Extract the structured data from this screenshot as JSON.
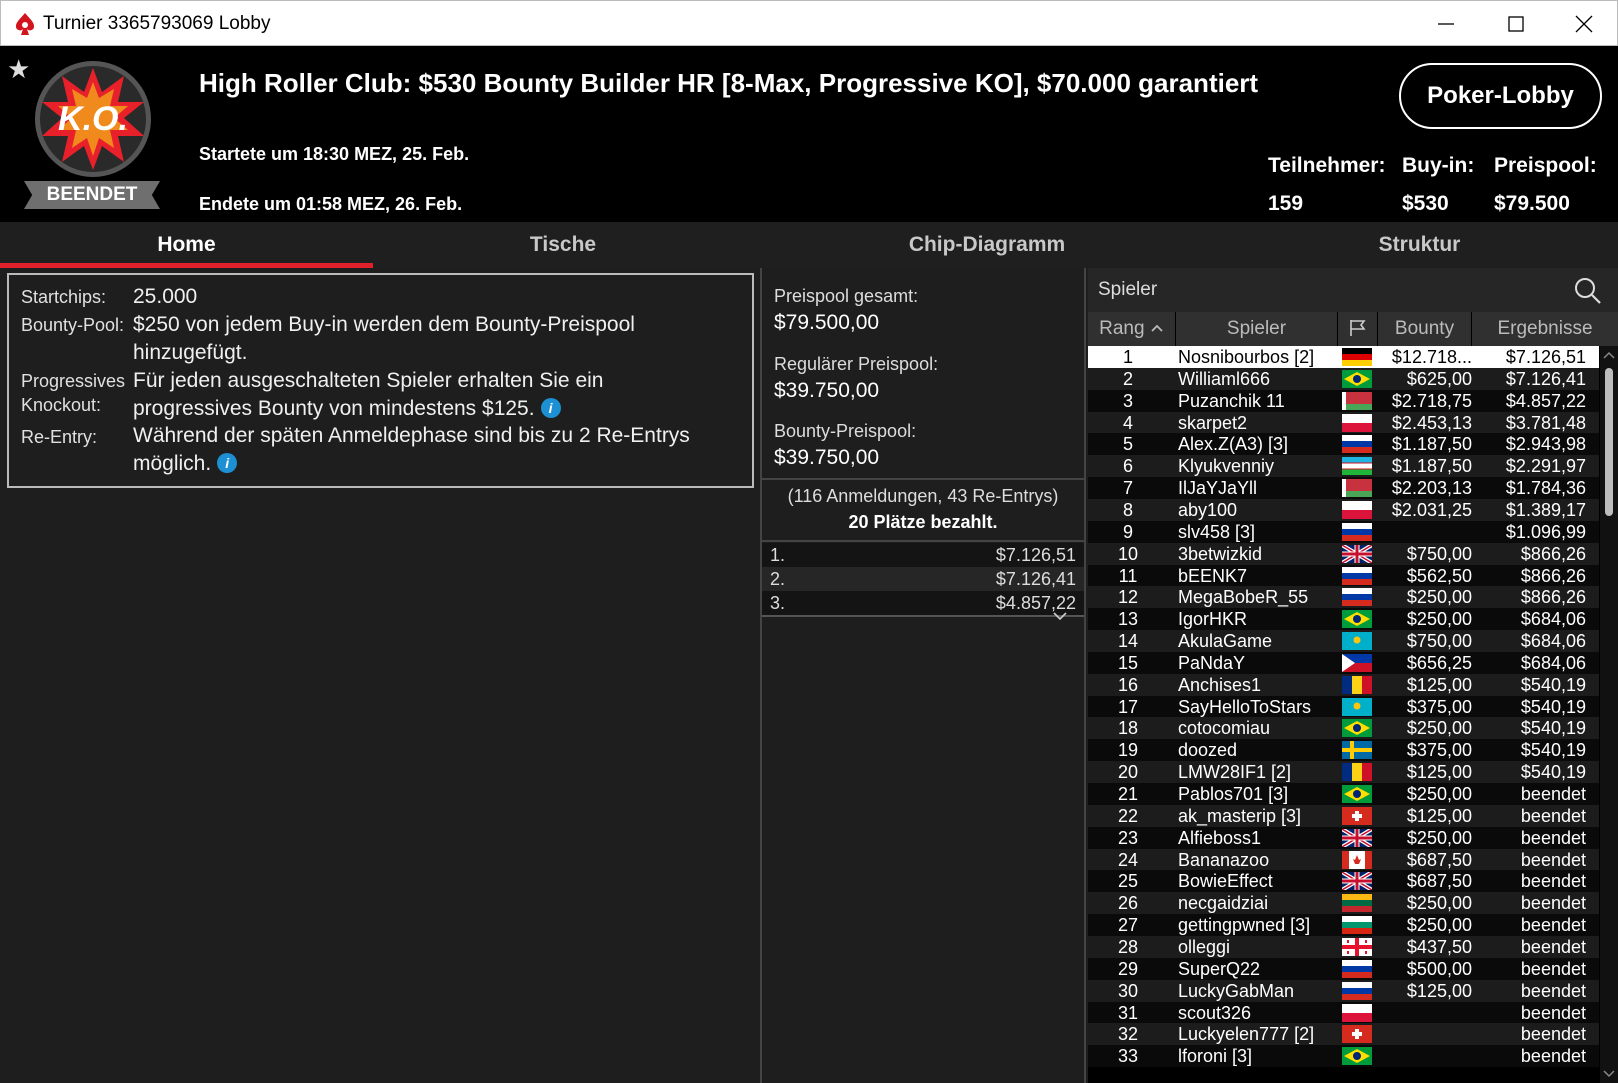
{
  "window": {
    "title": "Turnier 3365793069 Lobby"
  },
  "header": {
    "status_badge": "BEENDET",
    "logo_text": "K.O.",
    "tournament_title": "High Roller Club: $530 Bounty Builder HR [8-Max, Progressive KO], $70.000 garantiert",
    "started": "Startete um 18:30 MEZ, 25. Feb.",
    "ended": "Endete um 01:58 MEZ, 26. Feb.",
    "lobby_button": "Poker-Lobby",
    "stats": [
      {
        "label": "Teilnehmer:",
        "value": "159"
      },
      {
        "label": "Buy-in:",
        "value": "$530"
      },
      {
        "label": "Preispool:",
        "value": "$79.500"
      }
    ]
  },
  "tabs": [
    "Home",
    "Tische",
    "Chip-Diagramm",
    "Struktur"
  ],
  "info": {
    "startchips_label": "Startchips:",
    "startchips_value": "25.000",
    "bounty_pool_label": "Bounty-Pool:",
    "bounty_pool_value": "$250 von jedem Buy-in werden dem Bounty-Preispool hinzugefügt.",
    "progressive_label_1": "Progressives",
    "progressive_label_2": "Knockout:",
    "progressive_value": "Für jeden ausgeschalteten Spieler erhalten Sie ein progressives Bounty von mindestens $125.",
    "reentry_label": "Re-Entry:",
    "reentry_value": "Während der späten Anmeldephase sind bis zu 2 Re-Entrys möglich.",
    "info_icon_glyph": "i"
  },
  "prizepool": {
    "total_label": "Preispool gesamt:",
    "total_value": "$79.500,00",
    "regular_label": "Regulärer Preispool:",
    "regular_value": "$39.750,00",
    "bounty_label": "Bounty-Preispool:",
    "bounty_value": "$39.750,00",
    "registrations": "(116 Anmeldungen, 43 Re-Entrys)",
    "paid_places": "20 Plätze bezahlt.",
    "payouts": [
      {
        "rank": "1.",
        "amount": "$7.126,51"
      },
      {
        "rank": "2.",
        "amount": "$7.126,41"
      },
      {
        "rank": "3.",
        "amount": "$4.857,22"
      }
    ]
  },
  "players": {
    "search_label": "Spieler",
    "columns": {
      "rank": "Rang",
      "player": "Spieler",
      "bounty": "Bounty",
      "result": "Ergebnisse"
    },
    "rows": [
      {
        "rank": "1",
        "name": "Nosnibourbos [2]",
        "flag": "de",
        "bounty": "$12.718...",
        "result": "$7.126,51"
      },
      {
        "rank": "2",
        "name": "Williaml666",
        "flag": "br",
        "bounty": "$625,00",
        "result": "$7.126,41"
      },
      {
        "rank": "3",
        "name": "Puzanchik 11",
        "flag": "by",
        "bounty": "$2.718,75",
        "result": "$4.857,22"
      },
      {
        "rank": "4",
        "name": "skarpet2",
        "flag": "pl",
        "bounty": "$2.453,13",
        "result": "$3.781,48"
      },
      {
        "rank": "5",
        "name": "Alex.Z(A3) [3]",
        "flag": "ru",
        "bounty": "$1.187,50",
        "result": "$2.943,98"
      },
      {
        "rank": "6",
        "name": "Klyukvenniy",
        "flag": "uz",
        "bounty": "$1.187,50",
        "result": "$2.291,97"
      },
      {
        "rank": "7",
        "name": "IlJaYJaYll",
        "flag": "by",
        "bounty": "$2.203,13",
        "result": "$1.784,36"
      },
      {
        "rank": "8",
        "name": "aby100",
        "flag": "pl",
        "bounty": "$2.031,25",
        "result": "$1.389,17"
      },
      {
        "rank": "9",
        "name": "slv458 [3]",
        "flag": "ru",
        "bounty": "",
        "result": "$1.096,99"
      },
      {
        "rank": "10",
        "name": "3betwizkid",
        "flag": "gb",
        "bounty": "$750,00",
        "result": "$866,26"
      },
      {
        "rank": "11",
        "name": "bEENK7",
        "flag": "ru",
        "bounty": "$562,50",
        "result": "$866,26"
      },
      {
        "rank": "12",
        "name": "MegaBobeR_55",
        "flag": "ru",
        "bounty": "$250,00",
        "result": "$866,26"
      },
      {
        "rank": "13",
        "name": "IgorHKR",
        "flag": "br",
        "bounty": "$250,00",
        "result": "$684,06"
      },
      {
        "rank": "14",
        "name": "AkulaGame",
        "flag": "kz",
        "bounty": "$750,00",
        "result": "$684,06"
      },
      {
        "rank": "15",
        "name": "PaNdaY",
        "flag": "ph",
        "bounty": "$656,25",
        "result": "$684,06"
      },
      {
        "rank": "16",
        "name": "Anchises1",
        "flag": "ro",
        "bounty": "$125,00",
        "result": "$540,19"
      },
      {
        "rank": "17",
        "name": "SayHelloToStars",
        "flag": "kz",
        "bounty": "$375,00",
        "result": "$540,19"
      },
      {
        "rank": "18",
        "name": "cotocomiau",
        "flag": "br",
        "bounty": "$250,00",
        "result": "$540,19"
      },
      {
        "rank": "19",
        "name": "doozed",
        "flag": "se",
        "bounty": "$375,00",
        "result": "$540,19"
      },
      {
        "rank": "20",
        "name": "LMW28IF1 [2]",
        "flag": "ro",
        "bounty": "$125,00",
        "result": "$540,19"
      },
      {
        "rank": "21",
        "name": "Pablos701 [3]",
        "flag": "br",
        "bounty": "$250,00",
        "result": "beendet"
      },
      {
        "rank": "22",
        "name": "ak_masterip [3]",
        "flag": "ch",
        "bounty": "$125,00",
        "result": "beendet"
      },
      {
        "rank": "23",
        "name": "Alfieboss1",
        "flag": "gb",
        "bounty": "$250,00",
        "result": "beendet"
      },
      {
        "rank": "24",
        "name": "Bananazoo",
        "flag": "ca",
        "bounty": "$687,50",
        "result": "beendet"
      },
      {
        "rank": "25",
        "name": "BowieEffect",
        "flag": "gb",
        "bounty": "$687,50",
        "result": "beendet"
      },
      {
        "rank": "26",
        "name": "necgaidziai",
        "flag": "lt",
        "bounty": "$250,00",
        "result": "beendet"
      },
      {
        "rank": "27",
        "name": "gettingpwned [3]",
        "flag": "bg",
        "bounty": "$250,00",
        "result": "beendet"
      },
      {
        "rank": "28",
        "name": "olleggi",
        "flag": "ge",
        "bounty": "$437,50",
        "result": "beendet"
      },
      {
        "rank": "29",
        "name": "SuperQ22",
        "flag": "ru",
        "bounty": "$500,00",
        "result": "beendet"
      },
      {
        "rank": "30",
        "name": "LuckyGabMan",
        "flag": "ru",
        "bounty": "$125,00",
        "result": "beendet"
      },
      {
        "rank": "31",
        "name": "scout326",
        "flag": "pl",
        "bounty": "",
        "result": "beendet"
      },
      {
        "rank": "32",
        "name": "Luckyelen777 [2]",
        "flag": "ch",
        "bounty": "",
        "result": "beendet"
      },
      {
        "rank": "33",
        "name": "lforoni [3]",
        "flag": "br",
        "bounty": "",
        "result": "beendet"
      }
    ]
  },
  "colors": {
    "accent_red": "#e0202a",
    "info_blue": "#1d8fd3",
    "badge_gray": "#6f6f6f"
  }
}
